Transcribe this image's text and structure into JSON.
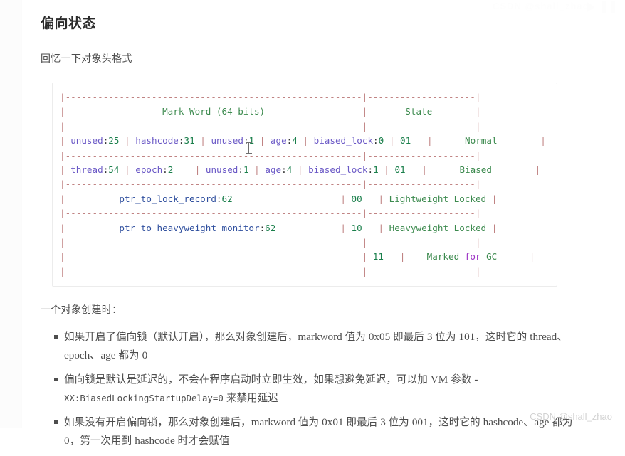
{
  "article": {
    "title": "偏向状态",
    "intro": "回忆一下对象头格式",
    "lead": "一个对象创建时："
  },
  "code_block": {
    "lines": [
      [
        {
          "t": "|",
          "c": "pipe"
        },
        {
          "t": "-------------------------------------------------------",
          "c": "dash"
        },
        {
          "t": "|",
          "c": "pipe"
        },
        {
          "t": "--------------------",
          "c": "dash"
        },
        {
          "t": "|",
          "c": "pipe"
        }
      ],
      [
        {
          "t": "|",
          "c": "pipe"
        },
        {
          "t": "                  ",
          "c": "plain"
        },
        {
          "t": "Mark Word (64 bits)",
          "c": "str"
        },
        {
          "t": "                  ",
          "c": "plain"
        },
        {
          "t": "|",
          "c": "pipe"
        },
        {
          "t": "       ",
          "c": "plain"
        },
        {
          "t": "State",
          "c": "str"
        },
        {
          "t": "        ",
          "c": "plain"
        },
        {
          "t": "|",
          "c": "pipe"
        }
      ],
      [
        {
          "t": "|",
          "c": "pipe"
        },
        {
          "t": "-------------------------------------------------------",
          "c": "dash"
        },
        {
          "t": "|",
          "c": "pipe"
        },
        {
          "t": "--------------------",
          "c": "dash"
        },
        {
          "t": "|",
          "c": "pipe"
        }
      ],
      [
        {
          "t": "|",
          "c": "pipe"
        },
        {
          "t": " ",
          "c": "plain"
        },
        {
          "t": "unused",
          "c": "ident"
        },
        {
          "t": ":",
          "c": "plain"
        },
        {
          "t": "25",
          "c": "num"
        },
        {
          "t": " ",
          "c": "plain"
        },
        {
          "t": "|",
          "c": "pipe"
        },
        {
          "t": " ",
          "c": "plain"
        },
        {
          "t": "hashcode",
          "c": "ident"
        },
        {
          "t": ":",
          "c": "plain"
        },
        {
          "t": "31",
          "c": "num"
        },
        {
          "t": " ",
          "c": "plain"
        },
        {
          "t": "|",
          "c": "pipe"
        },
        {
          "t": " ",
          "c": "plain"
        },
        {
          "t": "unused",
          "c": "ident"
        },
        {
          "t": ":",
          "c": "plain"
        },
        {
          "t": "1",
          "c": "num"
        },
        {
          "t": " ",
          "c": "plain"
        },
        {
          "t": "|",
          "c": "pipe"
        },
        {
          "t": " ",
          "c": "plain"
        },
        {
          "t": "age",
          "c": "ident"
        },
        {
          "t": ":",
          "c": "plain"
        },
        {
          "t": "4",
          "c": "num"
        },
        {
          "t": " ",
          "c": "plain"
        },
        {
          "t": "|",
          "c": "pipe"
        },
        {
          "t": " ",
          "c": "plain"
        },
        {
          "t": "biased_lock",
          "c": "ident"
        },
        {
          "t": ":",
          "c": "plain"
        },
        {
          "t": "0",
          "c": "num"
        },
        {
          "t": " ",
          "c": "plain"
        },
        {
          "t": "|",
          "c": "pipe"
        },
        {
          "t": " ",
          "c": "plain"
        },
        {
          "t": "01",
          "c": "num"
        },
        {
          "t": "   ",
          "c": "plain"
        },
        {
          "t": "|",
          "c": "pipe"
        },
        {
          "t": "      ",
          "c": "plain"
        },
        {
          "t": "Normal",
          "c": "str"
        },
        {
          "t": "        ",
          "c": "plain"
        },
        {
          "t": "|",
          "c": "pipe"
        }
      ],
      [
        {
          "t": "|",
          "c": "pipe"
        },
        {
          "t": "-------------------------------------------------------",
          "c": "dash"
        },
        {
          "t": "|",
          "c": "pipe"
        },
        {
          "t": "--------------------",
          "c": "dash"
        },
        {
          "t": "|",
          "c": "pipe"
        }
      ],
      [
        {
          "t": "|",
          "c": "pipe"
        },
        {
          "t": " ",
          "c": "plain"
        },
        {
          "t": "thread",
          "c": "ident"
        },
        {
          "t": ":",
          "c": "plain"
        },
        {
          "t": "54",
          "c": "num"
        },
        {
          "t": " ",
          "c": "plain"
        },
        {
          "t": "|",
          "c": "pipe"
        },
        {
          "t": " ",
          "c": "plain"
        },
        {
          "t": "epoch",
          "c": "ident"
        },
        {
          "t": ":",
          "c": "plain"
        },
        {
          "t": "2",
          "c": "num"
        },
        {
          "t": "    ",
          "c": "plain"
        },
        {
          "t": "|",
          "c": "pipe"
        },
        {
          "t": " ",
          "c": "plain"
        },
        {
          "t": "unused",
          "c": "ident"
        },
        {
          "t": ":",
          "c": "plain"
        },
        {
          "t": "1",
          "c": "num"
        },
        {
          "t": " ",
          "c": "plain"
        },
        {
          "t": "|",
          "c": "pipe"
        },
        {
          "t": " ",
          "c": "plain"
        },
        {
          "t": "age",
          "c": "ident"
        },
        {
          "t": ":",
          "c": "plain"
        },
        {
          "t": "4",
          "c": "num"
        },
        {
          "t": " ",
          "c": "plain"
        },
        {
          "t": "|",
          "c": "pipe"
        },
        {
          "t": " ",
          "c": "plain"
        },
        {
          "t": "biased_lock",
          "c": "ident"
        },
        {
          "t": ":",
          "c": "plain"
        },
        {
          "t": "1",
          "c": "num"
        },
        {
          "t": " ",
          "c": "plain"
        },
        {
          "t": "|",
          "c": "pipe"
        },
        {
          "t": " ",
          "c": "plain"
        },
        {
          "t": "01",
          "c": "num"
        },
        {
          "t": "   ",
          "c": "plain"
        },
        {
          "t": "|",
          "c": "pipe"
        },
        {
          "t": "      ",
          "c": "plain"
        },
        {
          "t": "Biased",
          "c": "str"
        },
        {
          "t": "        ",
          "c": "plain"
        },
        {
          "t": "|",
          "c": "pipe"
        }
      ],
      [
        {
          "t": "|",
          "c": "pipe"
        },
        {
          "t": "-------------------------------------------------------",
          "c": "dash"
        },
        {
          "t": "|",
          "c": "pipe"
        },
        {
          "t": "--------------------",
          "c": "dash"
        },
        {
          "t": "|",
          "c": "pipe"
        }
      ],
      [
        {
          "t": "|",
          "c": "pipe"
        },
        {
          "t": "          ",
          "c": "plain"
        },
        {
          "t": "ptr_to_lock_record",
          "c": "name"
        },
        {
          "t": ":",
          "c": "plain"
        },
        {
          "t": "62",
          "c": "num"
        },
        {
          "t": "                    ",
          "c": "plain"
        },
        {
          "t": "|",
          "c": "pipe"
        },
        {
          "t": " ",
          "c": "plain"
        },
        {
          "t": "00",
          "c": "num"
        },
        {
          "t": "   ",
          "c": "plain"
        },
        {
          "t": "|",
          "c": "pipe"
        },
        {
          "t": " ",
          "c": "plain"
        },
        {
          "t": "Lightweight Locked",
          "c": "str"
        },
        {
          "t": " ",
          "c": "plain"
        },
        {
          "t": "|",
          "c": "pipe"
        }
      ],
      [
        {
          "t": "|",
          "c": "pipe"
        },
        {
          "t": "-------------------------------------------------------",
          "c": "dash"
        },
        {
          "t": "|",
          "c": "pipe"
        },
        {
          "t": "--------------------",
          "c": "dash"
        },
        {
          "t": "|",
          "c": "pipe"
        }
      ],
      [
        {
          "t": "|",
          "c": "pipe"
        },
        {
          "t": "          ",
          "c": "plain"
        },
        {
          "t": "ptr_to_heavyweight_monitor",
          "c": "name"
        },
        {
          "t": ":",
          "c": "plain"
        },
        {
          "t": "62",
          "c": "num"
        },
        {
          "t": "            ",
          "c": "plain"
        },
        {
          "t": "|",
          "c": "pipe"
        },
        {
          "t": " ",
          "c": "plain"
        },
        {
          "t": "10",
          "c": "num"
        },
        {
          "t": "   ",
          "c": "plain"
        },
        {
          "t": "|",
          "c": "pipe"
        },
        {
          "t": " ",
          "c": "plain"
        },
        {
          "t": "Heavyweight Locked",
          "c": "str"
        },
        {
          "t": " ",
          "c": "plain"
        },
        {
          "t": "|",
          "c": "pipe"
        }
      ],
      [
        {
          "t": "|",
          "c": "pipe"
        },
        {
          "t": "-------------------------------------------------------",
          "c": "dash"
        },
        {
          "t": "|",
          "c": "pipe"
        },
        {
          "t": "--------------------",
          "c": "dash"
        },
        {
          "t": "|",
          "c": "pipe"
        }
      ],
      [
        {
          "t": "|",
          "c": "pipe"
        },
        {
          "t": "                                                       ",
          "c": "plain"
        },
        {
          "t": "|",
          "c": "pipe"
        },
        {
          "t": " ",
          "c": "plain"
        },
        {
          "t": "11",
          "c": "num"
        },
        {
          "t": "   ",
          "c": "plain"
        },
        {
          "t": "|",
          "c": "pipe"
        },
        {
          "t": "    ",
          "c": "plain"
        },
        {
          "t": "Marked",
          "c": "str"
        },
        {
          "t": " ",
          "c": "plain"
        },
        {
          "t": "for",
          "c": "kw"
        },
        {
          "t": " ",
          "c": "plain"
        },
        {
          "t": "GC",
          "c": "str"
        },
        {
          "t": "      ",
          "c": "plain"
        },
        {
          "t": "|",
          "c": "pipe"
        }
      ],
      [
        {
          "t": "|",
          "c": "pipe"
        },
        {
          "t": "-------------------------------------------------------",
          "c": "dash"
        },
        {
          "t": "|",
          "c": "pipe"
        },
        {
          "t": "--------------------",
          "c": "dash"
        },
        {
          "t": "|",
          "c": "pipe"
        }
      ]
    ],
    "table_semantics": {
      "headers": [
        "Mark Word (64 bits)",
        "State"
      ],
      "rows": [
        {
          "fields": "unused:25 | hashcode:31 | unused:1 | age:4 | biased_lock:0 | 01",
          "state": "Normal"
        },
        {
          "fields": "thread:54 | epoch:2 | unused:1 | age:4 | biased_lock:1 | 01",
          "state": "Biased"
        },
        {
          "fields": "ptr_to_lock_record:62 | 00",
          "state": "Lightweight Locked"
        },
        {
          "fields": "ptr_to_heavyweight_monitor:62 | 10",
          "state": "Heavyweight Locked"
        },
        {
          "fields": "11",
          "state": "Marked for GC"
        }
      ]
    }
  },
  "bullets": [
    {
      "parts": [
        {
          "t": "如果开启了偏向锁（默认开启），那么对象创建后，",
          "k": "cn"
        },
        {
          "t": "markword ",
          "k": "en"
        },
        {
          "t": "值为 ",
          "k": "cn"
        },
        {
          "t": "0x05 ",
          "k": "en"
        },
        {
          "t": "即最后 ",
          "k": "cn"
        },
        {
          "t": "3 ",
          "k": "en"
        },
        {
          "t": "位为 ",
          "k": "cn"
        },
        {
          "t": "101",
          "k": "en"
        },
        {
          "t": "，这时它的 ",
          "k": "cn"
        },
        {
          "t": "thread、epoch、age ",
          "k": "en"
        },
        {
          "t": "都为 ",
          "k": "cn"
        },
        {
          "t": "0",
          "k": "en"
        }
      ]
    },
    {
      "parts": [
        {
          "t": "偏向锁是默认是延迟的，不会在程序启动时立即生效，如果想避免延迟，可以加 ",
          "k": "cn"
        },
        {
          "t": "VM ",
          "k": "en"
        },
        {
          "t": "参数 ",
          "k": "cn"
        },
        {
          "t": "-",
          "k": "en"
        },
        {
          "t": "XX:BiasedLockingStartupDelay=0",
          "k": "code"
        },
        {
          "t": " 来禁用延迟",
          "k": "cn"
        }
      ]
    },
    {
      "parts": [
        {
          "t": "如果没有开启偏向锁，那么对象创建后，",
          "k": "cn"
        },
        {
          "t": "markword ",
          "k": "en"
        },
        {
          "t": "值为 ",
          "k": "cn"
        },
        {
          "t": "0x01 ",
          "k": "en"
        },
        {
          "t": "即最后 ",
          "k": "cn"
        },
        {
          "t": "3 ",
          "k": "en"
        },
        {
          "t": "位为 ",
          "k": "cn"
        },
        {
          "t": "001",
          "k": "en"
        },
        {
          "t": "，这时它的 ",
          "k": "cn"
        },
        {
          "t": "hashcode、age ",
          "k": "en"
        },
        {
          "t": "都为 ",
          "k": "cn"
        },
        {
          "t": "0",
          "k": "en"
        },
        {
          "t": "，第一次用到 ",
          "k": "cn"
        },
        {
          "t": "hashcode ",
          "k": "en"
        },
        {
          "t": "时才会赋值",
          "k": "cn"
        }
      ]
    }
  ],
  "watermarks": {
    "bottom": "CSDN @shall_zhao",
    "top": "CSDN @shall_zhao"
  },
  "colors": {
    "pipe": "#c08383",
    "identifier": "#6a58c6",
    "name": "#2f4f9e",
    "number": "#1a7f4b",
    "string": "#3c8a4e",
    "keyword": "#9b30c4",
    "text": "#4d4d4d",
    "heading": "#2b2b2b",
    "code_border": "#ececec",
    "watermark": "#d2d2d2"
  }
}
